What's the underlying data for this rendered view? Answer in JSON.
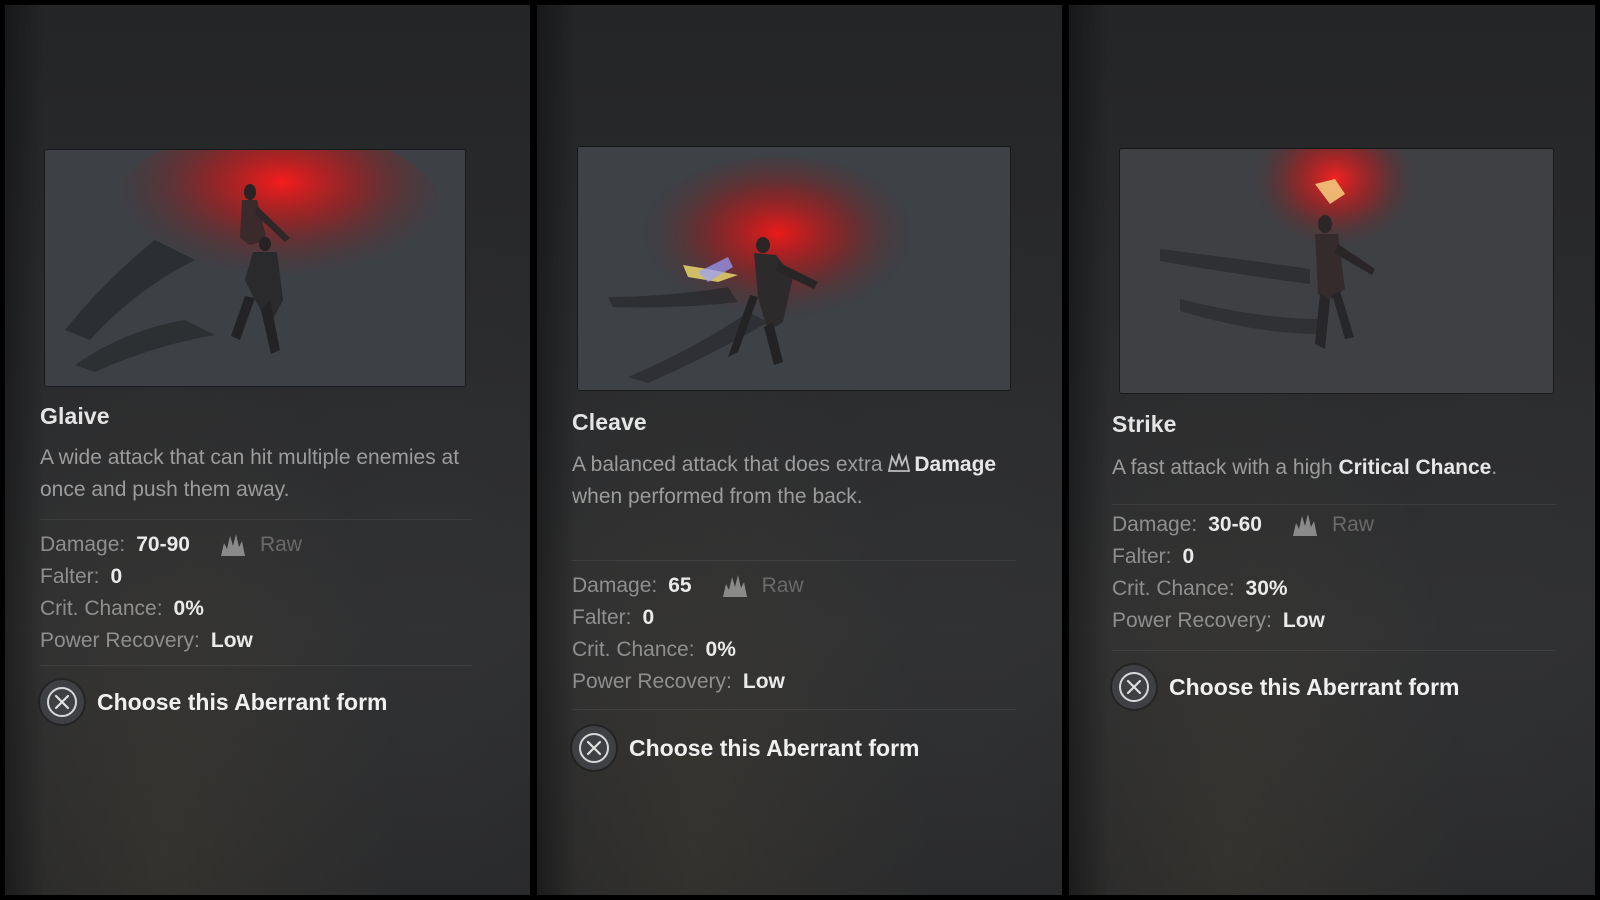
{
  "action_label": "Choose this Aberrant form",
  "stat_labels": {
    "damage": "Damage:",
    "falter": "Falter:",
    "crit": "Crit. Chance:",
    "power": "Power Recovery:"
  },
  "damage_type": "Raw",
  "icons": {
    "damage_type": "raw-damage-icon",
    "action_button": "cross-button-icon",
    "inline_damage": "damage-icon"
  },
  "cards": [
    {
      "title": "Glaive",
      "description": "A wide attack that can hit multiple enemies at once and push them away.",
      "damage": "70-90",
      "falter": "0",
      "crit_chance": "0%",
      "power_recovery": "Low"
    },
    {
      "title": "Cleave",
      "description_pre": "A balanced attack that does extra",
      "description_highlight": "Damage",
      "description_post": "when performed from the back.",
      "damage": "65",
      "falter": "0",
      "crit_chance": "0%",
      "power_recovery": "Low"
    },
    {
      "title": "Strike",
      "description_pre": "A fast attack with a high",
      "description_highlight": "Critical Chance",
      "description_post": ".",
      "damage": "30-60",
      "falter": "0",
      "crit_chance": "30%",
      "power_recovery": "Low"
    }
  ]
}
